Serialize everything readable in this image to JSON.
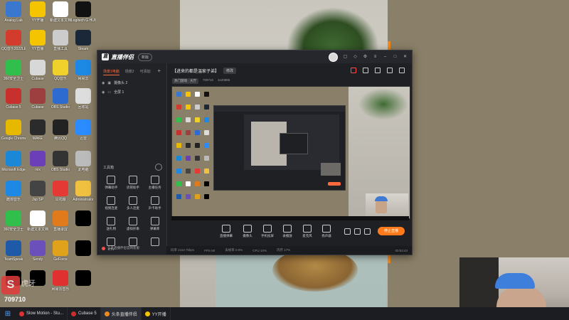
{
  "desktop": {
    "icons": [
      {
        "label": "Analog Lab",
        "color": "#3a78d0"
      },
      {
        "label": "YY开播",
        "color": "#f5c400"
      },
      {
        "label": "新建文本文档",
        "color": "#ffffff"
      },
      {
        "label": "Logitech G HUB",
        "color": "#111111"
      },
      {
        "label": "QQ音乐2022LED",
        "color": "#d33b2c"
      },
      {
        "label": "YY直播",
        "color": "#f5c400"
      },
      {
        "label": "直播工具",
        "color": "#cccccc"
      },
      {
        "label": "Steam",
        "color": "#1b2838"
      },
      {
        "label": "360安全卫士",
        "color": "#2fbf4a"
      },
      {
        "label": "Cubase",
        "color": "#d8d8d8"
      },
      {
        "label": "QQ音乐",
        "color": "#f0d12b"
      },
      {
        "label": "网易云",
        "color": "#1e88e5"
      },
      {
        "label": "Cubase 5",
        "color": "#c8302d"
      },
      {
        "label": "Cubase",
        "color": "#9e3f3f"
      },
      {
        "label": "OBS Studio",
        "color": "#2d6bd1"
      },
      {
        "label": "回收站",
        "color": "#dddddd"
      },
      {
        "label": "Google Chrome",
        "color": "#e6b800"
      },
      {
        "label": "MAKE",
        "color": "#2b2b2b"
      },
      {
        "label": "腾讯QQ",
        "color": "#222222"
      },
      {
        "label": "迅雷",
        "color": "#2a8cff"
      },
      {
        "label": "Microsoft Edge",
        "color": "#1a88d6"
      },
      {
        "label": "mix",
        "color": "#6a3fb8"
      },
      {
        "label": "OBS Studio",
        "color": "#333333"
      },
      {
        "label": "此电脑",
        "color": "#bbbbbb"
      },
      {
        "label": "酷狗音乐",
        "color": "#1e88e5"
      },
      {
        "label": "Jsp SP",
        "color": "#444444"
      },
      {
        "label": "同花顺",
        "color": "#e53935"
      },
      {
        "label": "Administrator",
        "color": "#f0c040"
      },
      {
        "label": "360安全卫士",
        "color": "#2fbf4a"
      },
      {
        "label": "新建文本文档",
        "color": "#ffffff"
      },
      {
        "label": "直播录屏",
        "color": "#e07a1a"
      },
      {
        "label": "",
        "color": "#000000"
      },
      {
        "label": "TeamSpeak",
        "color": "#1e5aa8"
      },
      {
        "label": "Sendy",
        "color": "#6b4fbb"
      },
      {
        "label": "GeForce",
        "color": "#e0a21a"
      },
      {
        "label": "",
        "color": "#000000"
      },
      {
        "label": "",
        "color": "#000000"
      },
      {
        "label": "",
        "color": "#000000"
      },
      {
        "label": "网易云音乐",
        "color": "#e03030"
      },
      {
        "label": "",
        "color": "#000000"
      }
    ]
  },
  "app": {
    "title": "直播伴侣",
    "version": "新版",
    "left_tabs": [
      "场景1电脑",
      "场景2",
      "可添加"
    ],
    "scenes": [
      {
        "label": "摄像头 2"
      },
      {
        "label": "全屏 1"
      }
    ],
    "toolbox_title": "工具箱",
    "tools": [
      {
        "label": "弹幕助手"
      },
      {
        "label": "房管助手"
      },
      {
        "label": "主播任务"
      },
      {
        "label": "视频连麦"
      },
      {
        "label": "多人连麦"
      },
      {
        "label": "声卡助手"
      },
      {
        "label": "送礼物"
      },
      {
        "label": "虚拟形象"
      },
      {
        "label": "弹幕库"
      },
      {
        "label": "KTV"
      },
      {
        "label": ""
      },
      {
        "label": ""
      }
    ],
    "bottom_note": "头条直播伴侣官网客服",
    "stream_title": "【进来的都是温家子弟】",
    "edit_label": "修改",
    "stream_meta": {
      "category": "热门游戏 · 大厅",
      "id_text": "709710",
      "fans": "1120885"
    },
    "controls": [
      {
        "label": "直播弹幕"
      },
      {
        "label": "摄像头"
      },
      {
        "label": "手机投屏"
      },
      {
        "label": "录播放"
      },
      {
        "label": "麦克风"
      },
      {
        "label": "扬声器"
      }
    ],
    "start_label": "停止直播",
    "status": {
      "bitrate": "码率 2112.7kbps",
      "fps": "FPS 60",
      "drop": "丢帧率 0.0%",
      "cpu": "CPU 10%",
      "mem": "内存 17%",
      "time": "00:53:43"
    }
  },
  "watermark": {
    "brand": "S",
    "text": "虎牙",
    "id": "709710"
  },
  "taskbar": {
    "start": "⊞",
    "tasks": [
      {
        "label": "Slow Motion - Stu...",
        "color": "#e03030"
      },
      {
        "label": "Cubase 5",
        "color": "#c8302d"
      },
      {
        "label": "头条直播伴侣",
        "color": "#f08a1d"
      },
      {
        "label": "YY开播",
        "color": "#f5c400"
      }
    ]
  }
}
